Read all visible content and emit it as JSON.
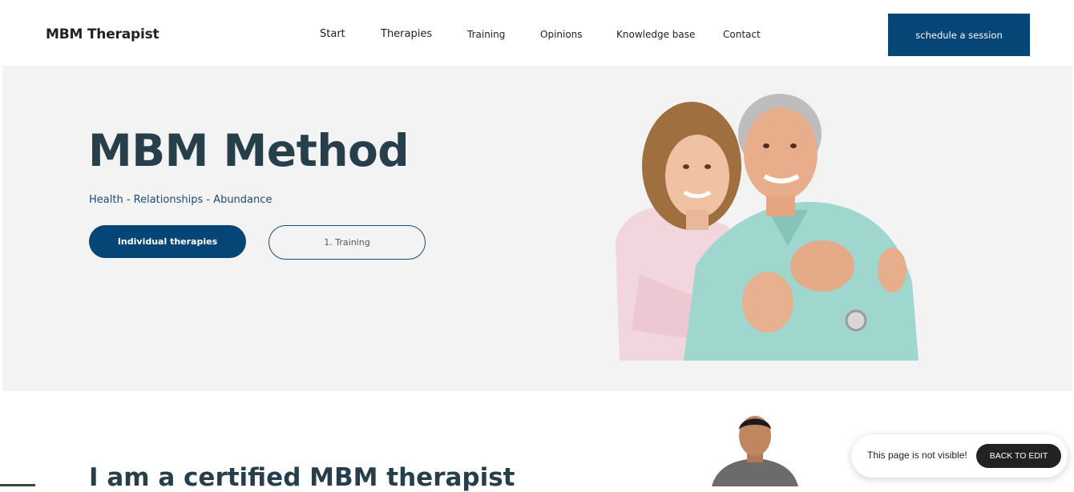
{
  "header": {
    "logo": "MBM Therapist",
    "nav": [
      "Start",
      "Therapies",
      "Training",
      "Opinions",
      "Knowledge base",
      "Contact"
    ],
    "cta_label": "schedule a session"
  },
  "hero": {
    "title": "MBM Method",
    "subtitle": "Health - Relationships - Abundance",
    "primary_button": "Individual therapies",
    "secondary_button": "1. Training"
  },
  "section2": {
    "title": "I am a certified MBM therapist"
  },
  "toast": {
    "message": "This page is not visible!",
    "button": "BACK TO EDIT"
  },
  "colors": {
    "brand": "#064677",
    "heading": "#273f4b",
    "hero_bg": "#f3f3f3"
  }
}
